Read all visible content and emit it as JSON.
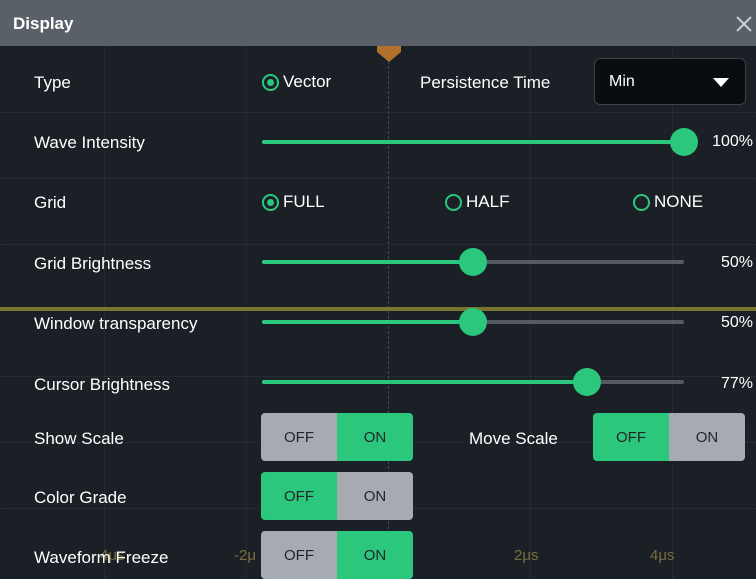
{
  "dialog": {
    "title": "Display"
  },
  "axis_labels": [
    "4μs",
    "-2μ",
    "2μs",
    "4μs"
  ],
  "colors": {
    "accent": "#2bc77d",
    "titlebar": "#5a6068",
    "toggle_off": "#a5abb1",
    "trace": "#7a7433"
  },
  "type": {
    "label": "Type",
    "option": "Vector",
    "selected": true
  },
  "persistence": {
    "label": "Persistence Time",
    "value": "Min"
  },
  "wave_intensity": {
    "label": "Wave Intensity",
    "value": 100,
    "display": "100%"
  },
  "grid": {
    "label": "Grid",
    "options": [
      {
        "label": "FULL",
        "selected": true
      },
      {
        "label": "HALF",
        "selected": false
      },
      {
        "label": "NONE",
        "selected": false
      }
    ]
  },
  "grid_brightness": {
    "label": "Grid Brightness",
    "value": 50,
    "display": "50%"
  },
  "window_transparency": {
    "label": "Window transparency",
    "value": 50,
    "display": "50%"
  },
  "cursor_brightness": {
    "label": "Cursor Brightness",
    "value": 77,
    "display": "77%"
  },
  "show_scale": {
    "label": "Show Scale",
    "off": "OFF",
    "on": "ON",
    "state": "ON"
  },
  "move_scale": {
    "label": "Move Scale",
    "off": "OFF",
    "on": "ON",
    "state": "OFF"
  },
  "color_grade": {
    "label": "Color Grade",
    "off": "OFF",
    "on": "ON",
    "state": "OFF"
  },
  "waveform_freeze": {
    "label": "Waveform Freeze",
    "off": "OFF",
    "on": "ON",
    "state": "ON"
  }
}
